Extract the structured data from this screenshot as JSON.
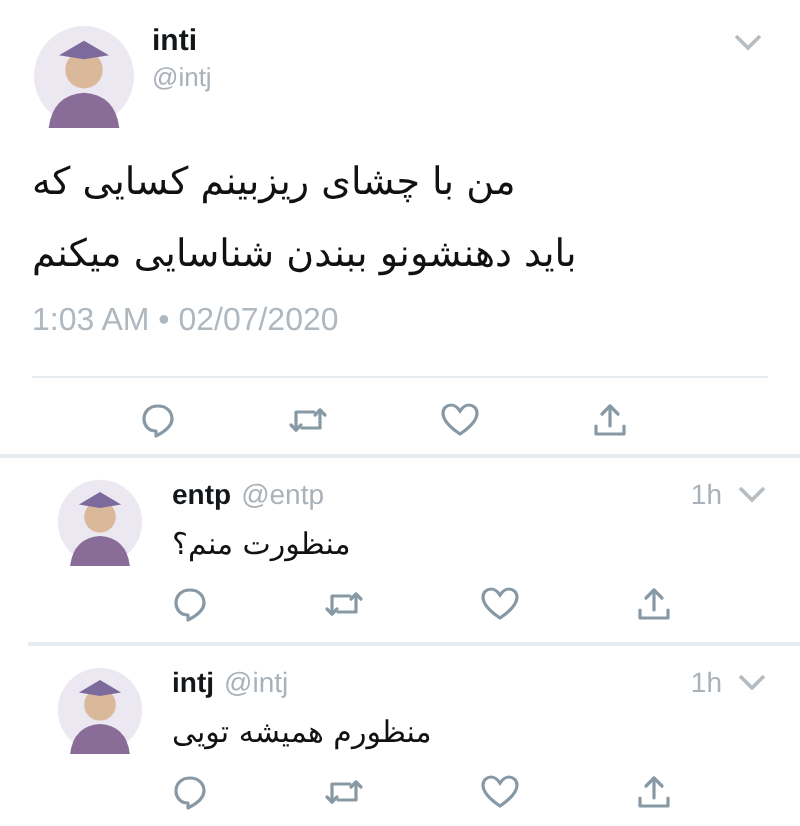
{
  "tweet": {
    "name": "inti",
    "handle": "@intj",
    "text_lines": [
      "من با چشای ریزبینم کسایی که",
      "باید دهنشونو ببندن شناسایی میکنم"
    ],
    "timestamp": "1:03 AM • 02/07/2020"
  },
  "replies": [
    {
      "name": "entp",
      "handle": "@entp",
      "time": "1h",
      "text": "منظورت منم؟"
    },
    {
      "name": "intj",
      "handle": "@intj",
      "time": "1h",
      "text": "منظورم همیشه تویی"
    }
  ]
}
